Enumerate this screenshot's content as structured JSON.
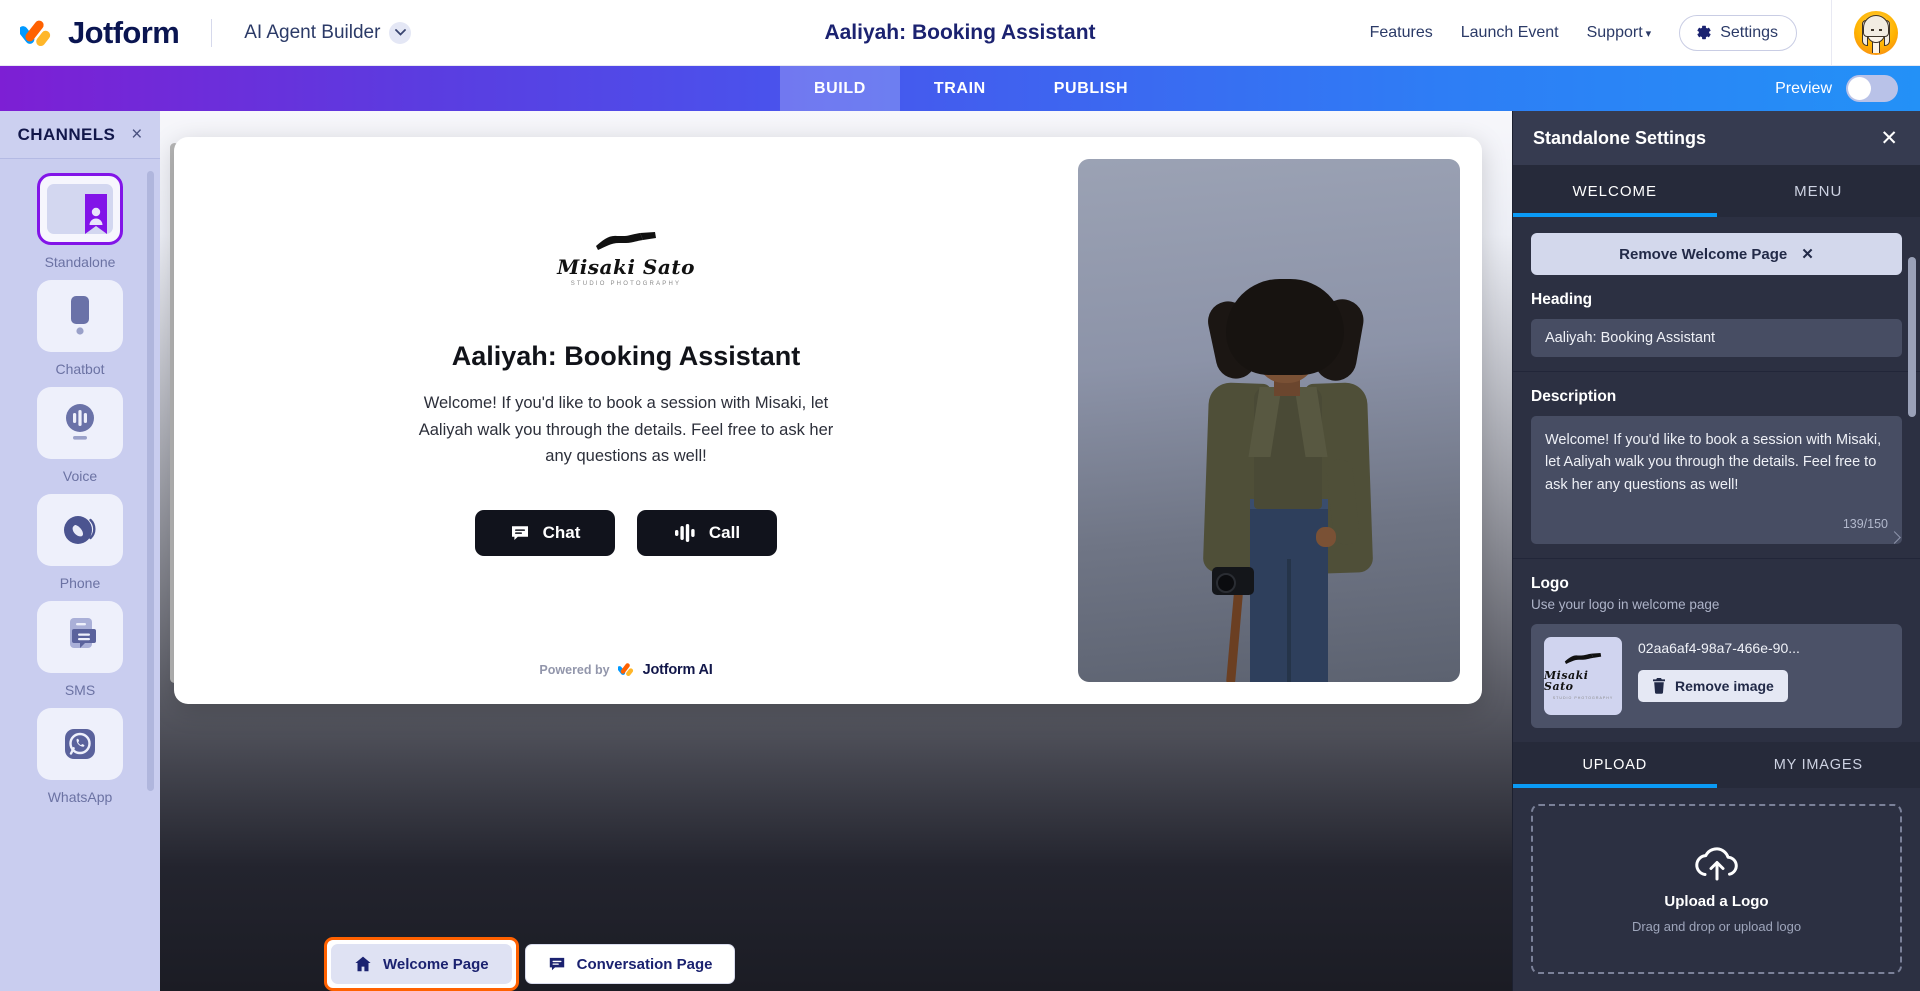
{
  "header": {
    "brand": "Jotform",
    "product": "AI Agent Builder",
    "title": "Aaliyah: Booking Assistant",
    "links": [
      {
        "label": "Features"
      },
      {
        "label": "Launch Event"
      },
      {
        "label": "Support",
        "caret": "⌄"
      }
    ],
    "settings_label": "Settings"
  },
  "nav": {
    "tabs": [
      {
        "label": "BUILD",
        "active": true
      },
      {
        "label": "TRAIN",
        "active": false
      },
      {
        "label": "PUBLISH",
        "active": false
      }
    ],
    "preview_label": "Preview",
    "preview_on": false
  },
  "channels": {
    "title": "CHANNELS",
    "close": "×",
    "items": [
      {
        "label": "Standalone",
        "icon": "standalone-icon",
        "selected": true
      },
      {
        "label": "Chatbot",
        "icon": "chatbot-icon",
        "selected": false
      },
      {
        "label": "Voice",
        "icon": "voice-icon",
        "selected": false
      },
      {
        "label": "Phone",
        "icon": "phone-icon",
        "selected": false
      },
      {
        "label": "SMS",
        "icon": "sms-icon",
        "selected": false
      },
      {
        "label": "WhatsApp",
        "icon": "whatsapp-icon",
        "selected": false
      }
    ]
  },
  "welcome_preview": {
    "logo_name": "Misaki Sato",
    "logo_tagline": "STUDIO PHOTOGRAPHY",
    "title": "Aaliyah: Booking Assistant",
    "description": "Welcome! If you'd like to book a session with Misaki, let Aaliyah walk you through the details. Feel free to ask her any questions as well!",
    "buttons": [
      {
        "label": "Chat",
        "icon": "chat-bubble-icon"
      },
      {
        "label": "Call",
        "icon": "waveform-icon"
      }
    ],
    "powered_by": "Powered by",
    "powered_brand": "Jotform AI"
  },
  "bottom_tabs": [
    {
      "label": "Welcome Page",
      "icon": "home-icon",
      "active": true,
      "focused": true
    },
    {
      "label": "Conversation Page",
      "icon": "chat-bubble-icon",
      "active": false,
      "focused": false
    }
  ],
  "settings": {
    "panel_title": "Standalone Settings",
    "close": "✕",
    "tabs": [
      {
        "label": "WELCOME",
        "active": true
      },
      {
        "label": "MENU",
        "active": false
      }
    ],
    "remove_welcome_page": "Remove Welcome Page",
    "remove_welcome_page_x": "✕",
    "heading_label": "Heading",
    "heading_value": "Aaliyah: Booking Assistant",
    "description_label": "Description",
    "description_value": "Welcome! If you'd like to book a session with Misaki, let Aaliyah walk you through the details. Feel free to ask her any questions as well!",
    "char_count": "139/150",
    "logo_label": "Logo",
    "logo_sub": "Use your logo in welcome page",
    "logo_filename": "02aa6af4-98a7-466e-90...",
    "remove_image_label": "Remove image",
    "upload_tabs": [
      {
        "label": "UPLOAD",
        "active": true
      },
      {
        "label": "MY IMAGES",
        "active": false
      }
    ],
    "dropzone_title": "Upload a Logo",
    "dropzone_sub": "Drag and drop or upload logo"
  },
  "colors": {
    "accent_blue": "#0a9af5",
    "brand_navy": "#12174a",
    "selected_purple": "#8214e8",
    "focus_orange": "#ff6100",
    "panel_dark": "#2c3042"
  }
}
